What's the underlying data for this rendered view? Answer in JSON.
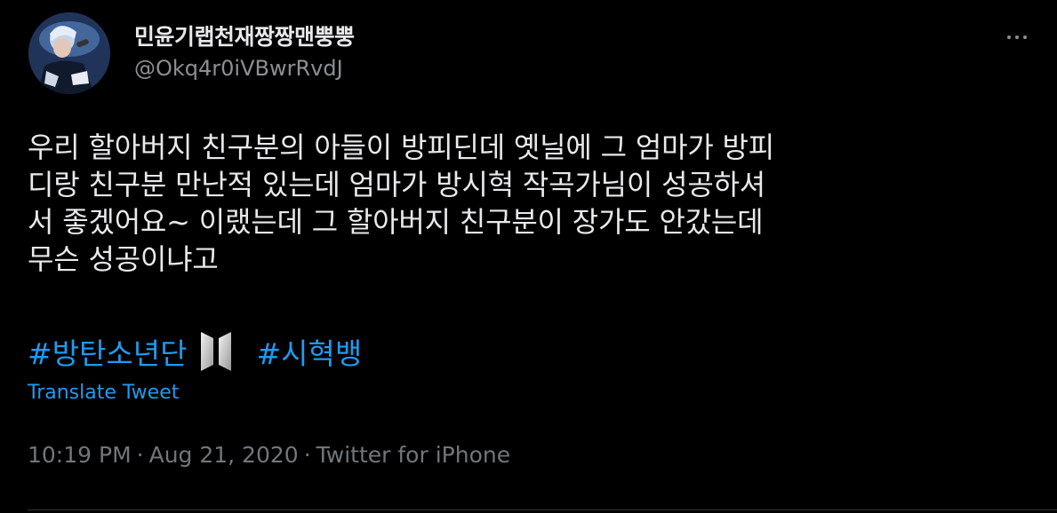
{
  "author": {
    "display_name": "민윤기랩천재짱짱맨뿡뿡",
    "handle": "@Okq4r0iVBwrRvdJ",
    "avatar_icon": "user-avatar-photo"
  },
  "tweet": {
    "text_lines": [
      "우리 할아버지 친구분의 아들이 방피딘데 옛닐에 그 엄마가 방피",
      "디랑 친구분 만난적 있는데 엄마가 방시혁 작곡가님이 성공하셔",
      "서 좋겠어요~ 이랬는데 그 할아버지 친구분이 장가도 안갔는데",
      "무슨 성공이냐고"
    ],
    "hashtags": [
      "#방탄소년단",
      "#시혁뱅"
    ],
    "hashtag_emoji_icon": "bts-logo-emoji",
    "translate_label": "Translate Tweet",
    "time": "10:19 PM",
    "date": "Aug 21, 2020",
    "source": "Twitter for iPhone",
    "meta_separator": "·"
  },
  "colors": {
    "background": "#000000",
    "primary_text": "#e7e9ea",
    "secondary_text": "#71767b",
    "link": "#1d9bf0"
  },
  "icons": {
    "more": "more-horizontal-icon"
  }
}
